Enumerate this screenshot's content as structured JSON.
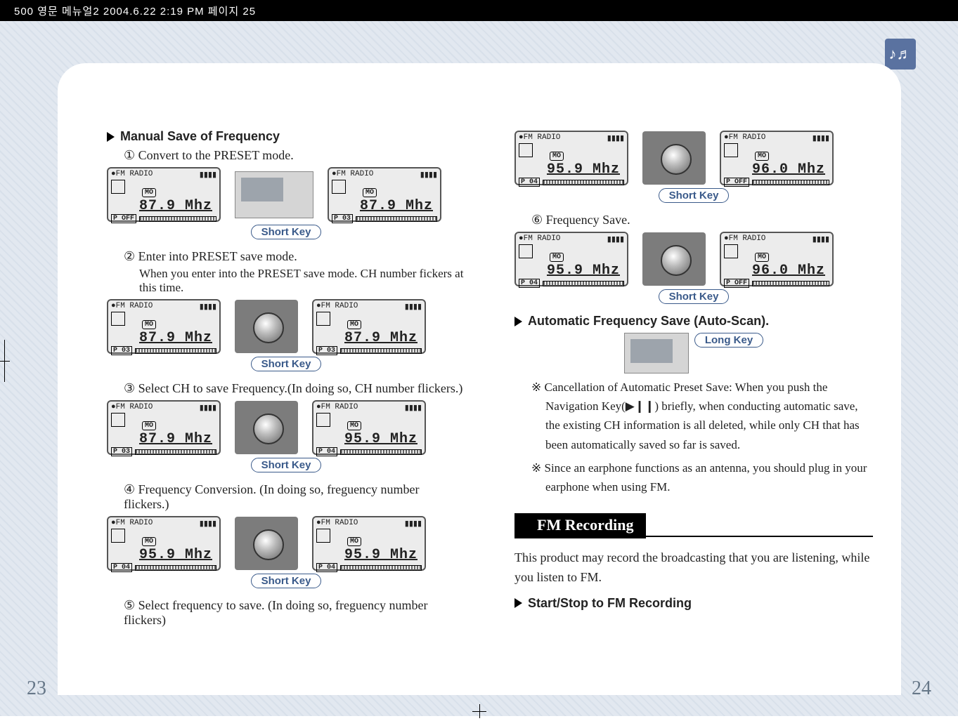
{
  "header_text": "500 영문 메뉴얼2  2004.6.22 2:19 PM  페이지 25",
  "page_left": "23",
  "page_right": "24",
  "left": {
    "heading": "Manual Save of Frequency",
    "steps": {
      "s1_num": "①",
      "s1_text": "Convert to the PRESET mode.",
      "s2_num": "②",
      "s2_text": "Enter into PRESET save mode.",
      "s2_note": "When you enter into the PRESET save mode. CH number fickers at this time.",
      "s3_num": "③",
      "s3_text": "Select CH to save Frequency.(In doing so, CH number flickers.)",
      "s4_num": "④",
      "s4_text": "Frequency Conversion. (In doing so, freguency number flickers.)",
      "s5_num": "⑤",
      "s5_text": "Select frequency to save. (In doing so, freguency number  flickers)"
    },
    "short_key_label": "Short Key",
    "lcd": {
      "title": "●FM RADIO",
      "mo": "MO",
      "freq_87": "87.9 Mhz",
      "freq_95": "95.9 Mhz",
      "p_off": "P OFF",
      "p03": "P 03",
      "p04": "P 04"
    }
  },
  "right": {
    "step6_num": "⑥",
    "step6_text": "Frequency Save.",
    "auto_heading": "Automatic Frequency Save (Auto-Scan).",
    "long_key_label": "Long Key",
    "short_key_label": "Short Key",
    "note1_star": "※",
    "note1": "Cancellation of Automatic Preset Save: When you push the Navigation Key(▶❙❙) briefly, when conducting automatic save, the existing CH information is all deleted, while only CH that has been automatically saved so far is saved.",
    "note2_star": "※",
    "note2": "Since an earphone functions as an antenna, you should plug in your earphone when using FM.",
    "section_title": "FM Recording",
    "section_intro": "This product may record the broadcasting that you are listening, while you listen to FM.",
    "rec_heading": "Start/Stop to FM Recording",
    "lcd": {
      "title": "●FM RADIO",
      "mo": "MO",
      "freq_95": "95.9 Mhz",
      "freq_96": "96.0 Mhz",
      "p_off": "P OFF",
      "p04": "P 04"
    }
  }
}
